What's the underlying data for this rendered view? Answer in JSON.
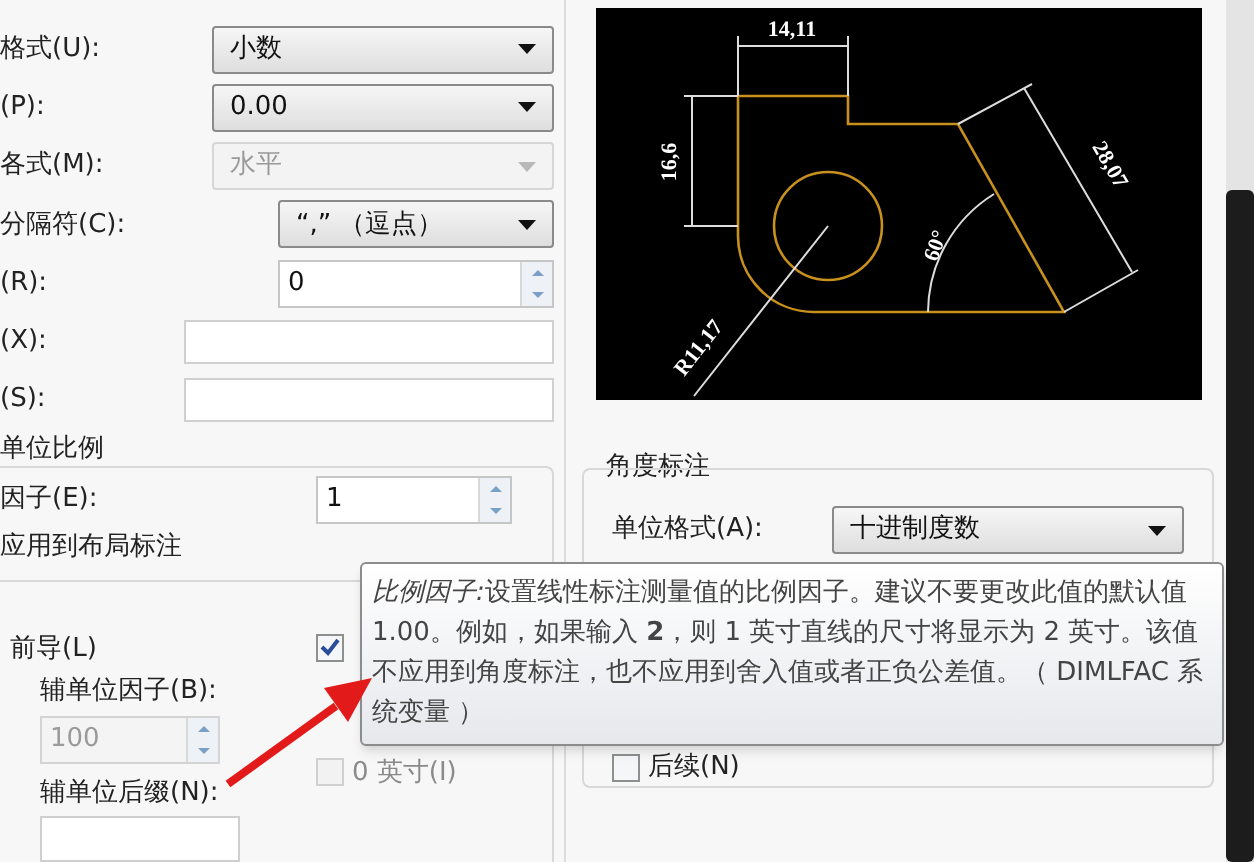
{
  "fields": [
    {
      "kind": "dropdown",
      "label": "格式(U):",
      "value": "小数",
      "disabled": false
    },
    {
      "kind": "dropdown",
      "label": "(P):",
      "value": "0.00",
      "disabled": false
    },
    {
      "kind": "dropdown",
      "label": "各式(M):",
      "value": "水平",
      "disabled": true
    },
    {
      "kind": "dropdown",
      "label": "分隔符(C):",
      "value": "“,” （逗点）",
      "disabled": false
    },
    {
      "kind": "spinner",
      "label": "(R):",
      "value": "0",
      "disabled": false
    },
    {
      "kind": "text",
      "label": "(X):",
      "disabled": false
    },
    {
      "kind": "text",
      "label": "(S):",
      "disabled": false
    }
  ],
  "scale_group": {
    "title": "单位比例",
    "factor_label": "因子(E):",
    "factor_value": "1",
    "layout_only_label": "应用到布局标注"
  },
  "zero_suppression": {
    "leading": {
      "label": "前导(L)",
      "checked": true
    },
    "sub_factor_label": "辅单位因子(B):",
    "sub_factor_value": "100",
    "sub_factor_disabled": true,
    "sub_suffix_label": "辅单位后缀(N):",
    "inch_zero": {
      "label": "0 英寸(I)",
      "checked": false,
      "disabled": true
    }
  },
  "preview": {
    "labels": [
      "14,11",
      "16,6",
      "R11,17",
      "60°",
      "28,07"
    ]
  },
  "angular": {
    "title": "角度标注",
    "unit_label": "单位格式(A):",
    "unit_value": "十进制度数",
    "trailing": {
      "label": "后续(N)",
      "checked": false
    }
  },
  "tooltip": {
    "term": "比例因子:",
    "text": "设置线性标注测量值的比例因子。建议不要更改此值的默认值 1.00。例如，如果输入 **2**，则 1 英寸直线的尺寸将显示为 2 英寸。该值不应用到角度标注，也不应用到舍入值或者正负公差值。（ DIMLFAC 系统变量 ）"
  }
}
